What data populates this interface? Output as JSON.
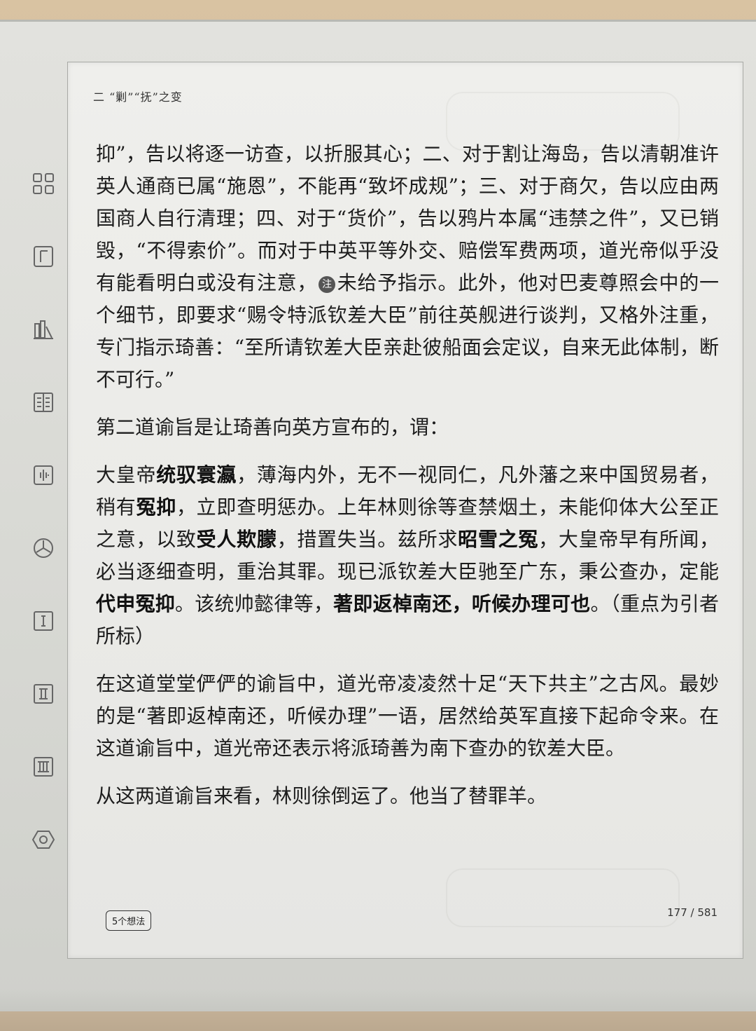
{
  "header": {
    "running_head": "二 “剿”“抚”之变"
  },
  "sidebar": {
    "icons": [
      "grid-icon",
      "bookmark-tab-icon",
      "bar-chart-icon",
      "book-columns-icon",
      "waveform-icon",
      "cube-icon",
      "volume-I-icon",
      "volume-II-icon",
      "volume-III-icon",
      "settings-hexagon-icon"
    ]
  },
  "content": {
    "p1_a": "抑”，告以将逐一访查，以折服其心；二、对于割让海岛，告以清朝准许英人通商已属“施恩”，不能再“致坏成规”；三、对于商欠，告以应由两国商人自行清理；四、对于“货价”，告以鸦片本属“违禁之件”，又已销毁，“不得索价”。而对于中英平等外交、赔偿军费两项，道光帝似乎没有能看明白或没有注意，",
    "note_mark": "注",
    "p1_b": "未给予指示。此外，他对巴麦尊照会中的一个细节，即要求“赐令特派钦差大臣”前往英舰进行谈判，又格外注重，专门指示琦善：“至所请钦差大臣亲赴彼船面会定议，自来无此体制，断不可行。”",
    "p2": "第二道谕旨是让琦善向英方宣布的，谓：",
    "p3_1": "大皇帝",
    "p3_2": "统驭寰瀛",
    "p3_3": "，薄海内外，无不一视同仁，凡外藩之来中国贸易者，稍有",
    "p3_4": "冤抑",
    "p3_5": "，立即查明惩办。上年林则徐等查禁烟土，未能仰体大公至正之意，以致",
    "p3_6": "受人欺朦",
    "p3_7": "，措置失当。兹所求",
    "p3_8": "昭雪之冤",
    "p3_9": "，大皇帝早有所闻，必当逐细查明，重治其罪。现已派钦差大臣驰至广东，秉公查办，定能",
    "p3_10": "代申冤抑",
    "p3_11": "。该统帅懿律等，",
    "p3_12": "著即返棹南还，听候办理可也",
    "p3_13": "。（重点为引者所标）",
    "p4": "在这道堂堂俨俨的谕旨中，道光帝凌凌然十足“天下共主”之古风。最妙的是“著即返棹南还，听候办理”一语，居然给英军直接下起命令来。在这道谕旨中，道光帝还表示将派琦善为南下查办的钦差大臣。",
    "p5": "从这两道谕旨来看，林则徐倒运了。他当了替罪羊。"
  },
  "footer": {
    "ideas_label": "5个想法",
    "page_indicator": "177 / 581"
  }
}
